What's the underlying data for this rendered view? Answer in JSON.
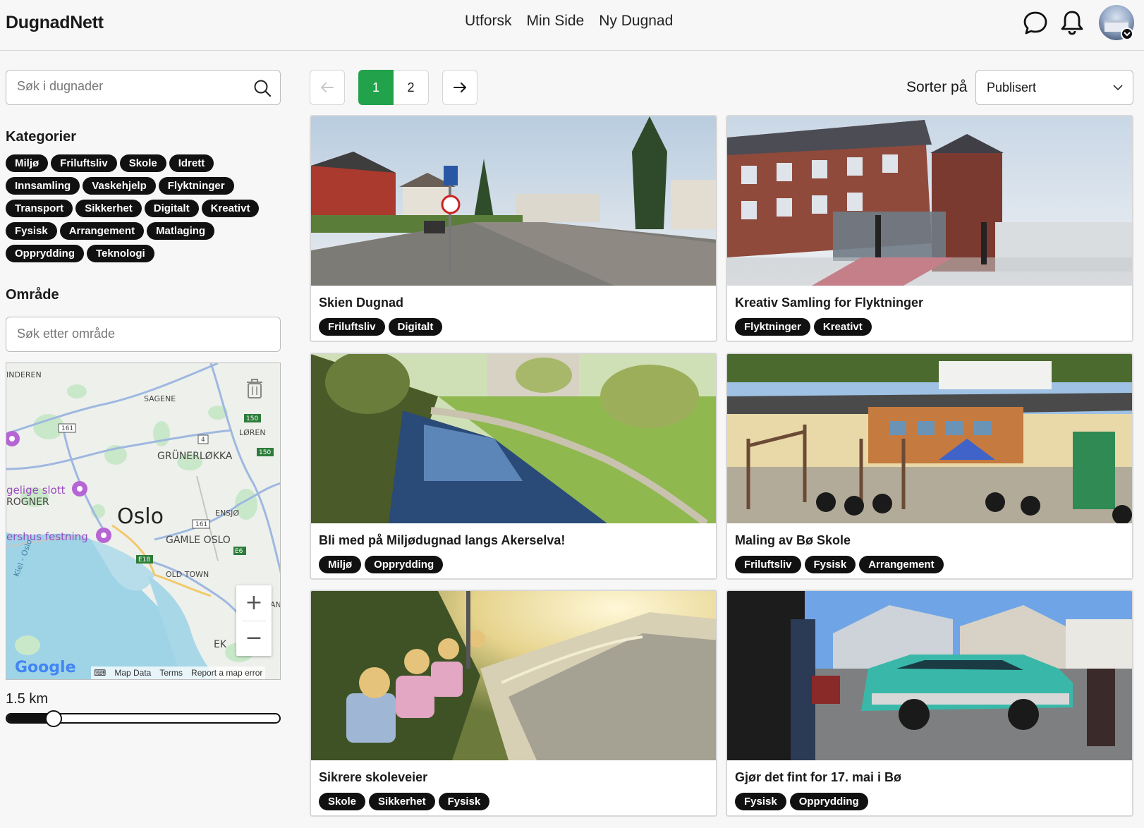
{
  "header": {
    "brand": "DugnadNett",
    "nav": [
      "Utforsk",
      "Min Side",
      "Ny Dugnad"
    ]
  },
  "sidebar": {
    "search_placeholder": "Søk i dugnader",
    "categories_title": "Kategorier",
    "categories": [
      "Miljø",
      "Friluftsliv",
      "Skole",
      "Idrett",
      "Innsamling",
      "Vaskehjelp",
      "Flyktninger",
      "Transport",
      "Sikkerhet",
      "Digitalt",
      "Kreativt",
      "Fysisk",
      "Arrangement",
      "Matlaging",
      "Opprydding",
      "Teknologi"
    ],
    "area_title": "Område",
    "area_placeholder": "Søk etter område",
    "map": {
      "labels": {
        "linderen": "INDEREN",
        "sagene": "SAGENE",
        "loren": "LØREN",
        "grunerlokka": "GRÜNERLØKKA",
        "slott": "gelige slott",
        "rogner": "ROGNER",
        "oslo": "Oslo",
        "ensjo": "ENSJØ",
        "festning": "ershus festning",
        "gamle_oslo": "GAMLE OSLO",
        "old_town": "OLD TOWN",
        "kiel": "Kiel - Oslo",
        "ek": "EK",
        "an": "AN"
      },
      "road_shields": [
        "161",
        "150",
        "4",
        "150",
        "161",
        "E18",
        "E6"
      ],
      "footer": [
        "Map Data",
        "Terms",
        "Report a map error"
      ],
      "google": "Google"
    },
    "distance_label": "1.5 km",
    "distance_fraction": 0.17
  },
  "toolbar": {
    "prev": "←",
    "pages": [
      "1",
      "2"
    ],
    "active_page": "1",
    "next": "→",
    "sort_label": "Sorter på",
    "sort_value": "Publisert"
  },
  "cards": [
    {
      "title": "Skien Dugnad",
      "tags": [
        "Friluftsliv",
        "Digitalt"
      ]
    },
    {
      "title": "Kreativ Samling for Flyktninger",
      "tags": [
        "Flyktninger",
        "Kreativt"
      ]
    },
    {
      "title": "Bli med på Miljødugnad langs Akerselva!",
      "tags": [
        "Miljø",
        "Opprydding"
      ]
    },
    {
      "title": "Maling av Bø Skole",
      "tags": [
        "Friluftsliv",
        "Fysisk",
        "Arrangement"
      ]
    },
    {
      "title": "Sikrere skoleveier",
      "tags": [
        "Skole",
        "Sikkerhet",
        "Fysisk"
      ]
    },
    {
      "title": "Gjør det fint for 17. mai i Bø",
      "tags": [
        "Fysisk",
        "Opprydding"
      ]
    }
  ],
  "colors": {
    "accent": "#22a24a",
    "chip": "#111111",
    "background": "#f7f7f7"
  }
}
